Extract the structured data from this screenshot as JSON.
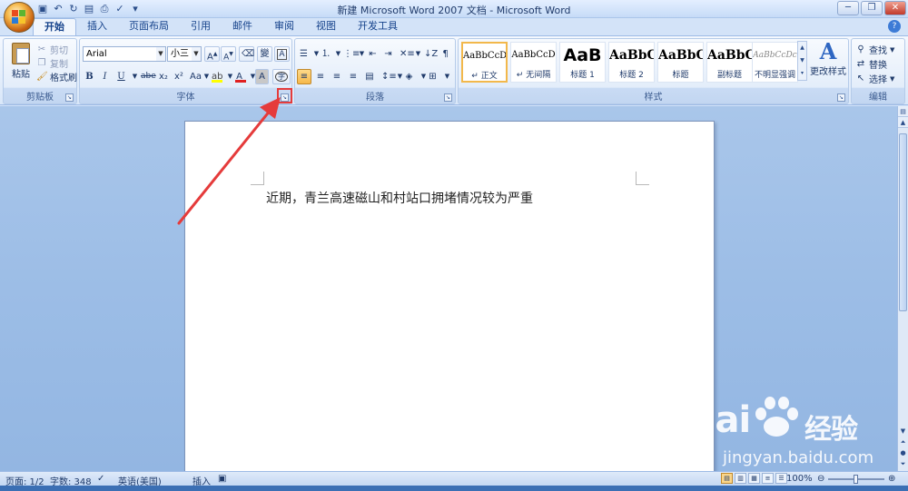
{
  "window": {
    "title": "新建 Microsoft Word 2007 文档 - Microsoft Word"
  },
  "tabs": [
    "开始",
    "插入",
    "页面布局",
    "引用",
    "邮件",
    "审阅",
    "视图",
    "开发工具"
  ],
  "clipboard": {
    "paste": "粘贴",
    "cut": "剪切",
    "copy": "复制",
    "format_painter": "格式刷",
    "label": "剪贴板"
  },
  "font": {
    "name": "Arial",
    "size": "小三",
    "grow": "A",
    "shrink": "A",
    "bold": "B",
    "italic": "I",
    "underline": "U",
    "strike": "abe",
    "subscript": "x₂",
    "superscript": "x²",
    "change_case": "Aa",
    "font_color": "A",
    "label": "字体"
  },
  "paragraph": {
    "label": "段落"
  },
  "styles": {
    "items": [
      {
        "sample": "AaBbCcD",
        "name": "↵ 正文"
      },
      {
        "sample": "AaBbCcD",
        "name": "↵ 无间隔"
      },
      {
        "sample": "AaB",
        "name": "标题 1"
      },
      {
        "sample": "AaBbC",
        "name": "标题 2"
      },
      {
        "sample": "AaBbC",
        "name": "标题"
      },
      {
        "sample": "AaBbC",
        "name": "副标题"
      },
      {
        "sample": "AaBbCcDc",
        "name": "不明显强调"
      }
    ],
    "change_styles": "更改样式",
    "label": "样式"
  },
  "editing": {
    "find": "查找",
    "replace": "替换",
    "select": "选择",
    "label": "编辑"
  },
  "document": {
    "text": "近期，青兰高速磁山和村站口拥堵情况较为严重"
  },
  "status": {
    "page": "页面: 1/2",
    "words": "字数: 348",
    "language": "英语(美国)",
    "insert_mode": "插入",
    "zoom": "100%"
  },
  "watermark": {
    "brand": "Bai",
    "brand2": "经验",
    "url": "jingyan.baidu.com"
  },
  "colors": {
    "annotation": "#e53b3b",
    "ribbon_text": "#15428b",
    "font_color_bar": "#e02020",
    "highlight_bar": "#ffff00"
  }
}
